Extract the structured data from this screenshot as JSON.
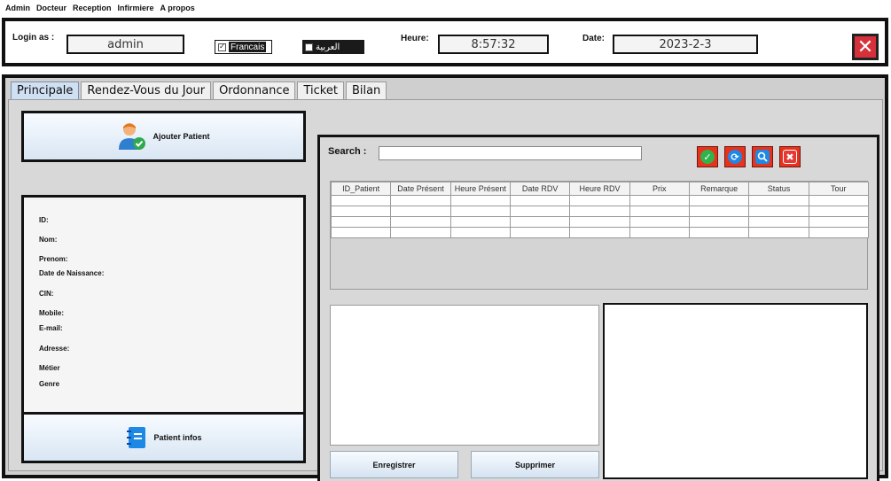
{
  "menu": [
    "Admin",
    "Docteur",
    "Reception",
    "Infirmiere",
    "A propos"
  ],
  "topbar": {
    "login_label": "Login as :",
    "login_value": "admin",
    "lang_fr": "Francais",
    "lang_ar": "العربية",
    "heure_label": "Heure:",
    "heure_value": "8:57:32",
    "date_label": "Date:",
    "date_value": "2023-2-3"
  },
  "tabs": [
    "Principale",
    "Rendez-Vous du Jour",
    "Ordonnance",
    "Ticket",
    "Bilan"
  ],
  "left": {
    "add_patient": "Ajouter Patient",
    "fields": [
      "ID:",
      "Nom:",
      "Prenom:",
      "Date de Naissance:",
      "CIN:",
      "Mobile:",
      "E-mail:",
      "Adresse:",
      "Métier",
      "Genre"
    ],
    "patient_infos": "Patient infos"
  },
  "right": {
    "search_label": "Search :",
    "search_value": "",
    "columns": [
      "ID_Patient",
      "Date Présent",
      "Heure Présent",
      "Date RDV",
      "Heure RDV",
      "Prix",
      "Remarque",
      "Status",
      "Tour"
    ],
    "save_label": "Enregistrer",
    "delete_label": "Supprimer"
  },
  "colors": {
    "accent_red": "#e8321e",
    "close_red": "#d6303a",
    "tab_active": "#cfe0f2"
  }
}
